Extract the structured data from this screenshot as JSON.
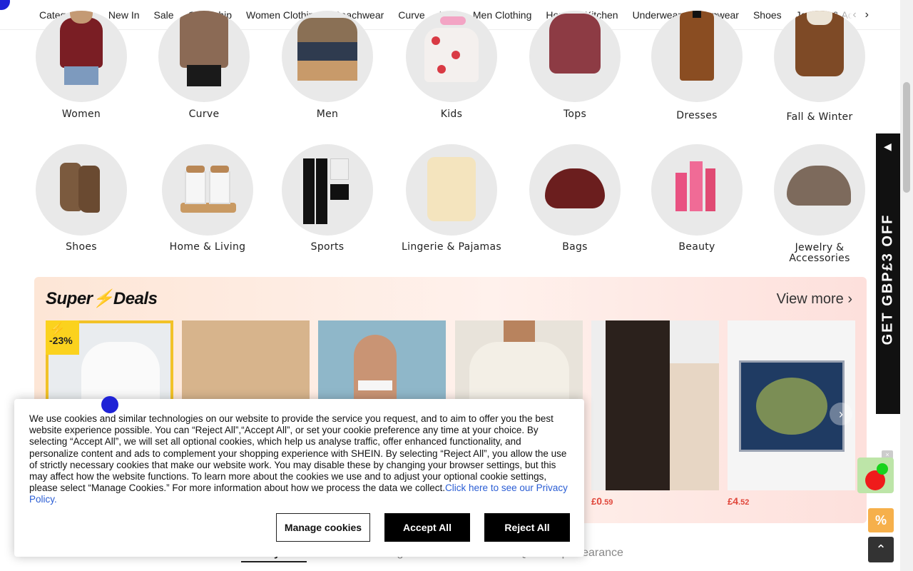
{
  "nav": {
    "items": [
      "Categories",
      "New In",
      "Sale",
      "Quickship",
      "Women Clothing",
      "Beachwear",
      "Curve",
      "Kids",
      "Men Clothing",
      "Home & Kitchen",
      "Underwear & sleepwear",
      "Shoes",
      "Jewelry & Accessories"
    ],
    "categories_caret": "⌄",
    "prev_arrow": "‹",
    "next_arrow": "›"
  },
  "categories_row1": [
    "Women",
    "Curve",
    "Men",
    "Kids",
    "Tops",
    "Dresses",
    "Fall & Winter"
  ],
  "categories_row2": [
    "Shoes",
    "Home & Living",
    "Sports",
    "Lingerie & Pajamas",
    "Bags",
    "Beauty",
    "Jewelry & Accessories"
  ],
  "super_deals": {
    "title_a": "Super",
    "title_b": "Deals",
    "view_more": "View more ›",
    "discount_badge": "-23%",
    "prices": [
      {
        "currency": "£",
        "whole": "0",
        "fraction": ".59"
      },
      {
        "currency": "£",
        "whole": "4",
        "fraction": ".52"
      }
    ]
  },
  "side_promo": {
    "text": "GET GBP£3 OFF",
    "arrow": "◀"
  },
  "tabs": [
    "Weekly Sale",
    "Starting from £0.99",
    "Quickship Clearance"
  ],
  "cookie": {
    "body": "We use cookies and similar technologies on our website to provide the service you request, and to aim to offer you the best website experience possible. You can “Reject All”,“Accept All”, or set your cookie preference any time at your choice. By selecting “Accept All”, we will set all optional cookies, which help us analyse traffic, offer enhanced functionality, and personalize content and ads to complement your shopping experience with SHEIN. By selecting “Reject All”, you allow the use of strictly necessary cookies that make our website work. You may disable these by changing your browser settings, but this may affect how the website functions. To learn more about the cookies we use and to adjust your optional cookie settings, please select “Manage Cookies.” For more information about how we process the data we collect.",
    "privacy_link": "Click here to see our Privacy Policy.",
    "manage": "Manage cookies",
    "accept": "Accept All",
    "reject": "Reject All"
  },
  "colors": {
    "accent_red": "#e0463a",
    "badge_yellow": "#fbd21e",
    "link_blue": "#2a5dd4"
  },
  "float": {
    "close": "×",
    "percent": "%",
    "top": "⌃"
  }
}
